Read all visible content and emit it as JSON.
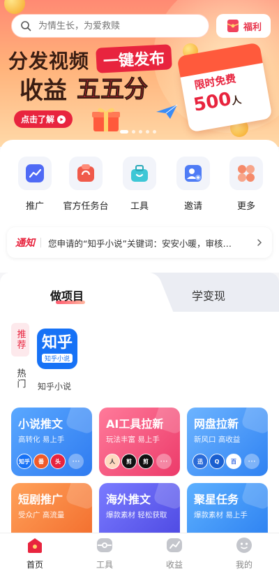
{
  "search": {
    "placeholder": "为情生长，为爱救赎"
  },
  "welfare": {
    "label": "福利",
    "icon": "red-envelope-icon"
  },
  "banner": {
    "line1": "分发视频",
    "pill": "一键发布",
    "line2": "收益",
    "line2_accent": "五五分",
    "cta": "点击了解",
    "calendar_line1": "限时免费",
    "calendar_number": "500",
    "calendar_unit": "人"
  },
  "quick_actions": [
    {
      "label": "推广",
      "icon": "trend-icon"
    },
    {
      "label": "官方任务台",
      "icon": "task-bag-icon"
    },
    {
      "label": "工具",
      "icon": "toolbox-icon"
    },
    {
      "label": "邀请",
      "icon": "invite-user-icon"
    },
    {
      "label": "更多",
      "icon": "grid-more-icon"
    }
  ],
  "notice": {
    "tag": "通知",
    "text": "您申请的“知乎小说”关键词：安安小暖，审核…"
  },
  "tabs": [
    {
      "label": "做项目"
    },
    {
      "label": "学变现"
    }
  ],
  "side_tabs": [
    {
      "label": "推荐"
    },
    {
      "label": "热门"
    }
  ],
  "featured": {
    "logo_big": "知乎",
    "logo_small": "知乎小说",
    "caption": "知乎小说"
  },
  "cards": [
    {
      "title": "小说推文",
      "sub": "高转化 易上手",
      "icons": [
        "知乎",
        "番",
        "头"
      ],
      "color": "#3e8ef7"
    },
    {
      "title": "AI工具拉新",
      "sub": "玩法丰富 易上手",
      "icons": [
        "人",
        "剪",
        "剪"
      ],
      "color": "#f2557a"
    },
    {
      "title": "网盘拉新",
      "sub": "新风口 高收益",
      "icons": [
        "迅",
        "Q",
        "百"
      ],
      "color": "#3c8cf5"
    },
    {
      "title": "短剧推广",
      "sub": "受众广 高流量",
      "icons": [],
      "color": "#f7813a"
    },
    {
      "title": "海外推文",
      "sub": "爆款素材 轻松获取",
      "icons": [],
      "color": "#5a5ff0"
    },
    {
      "title": "聚星任务",
      "sub": "爆款素材 易上手",
      "icons": [],
      "color": "#3a8cf6"
    }
  ],
  "bottom_nav": [
    {
      "label": "首页",
      "icon": "home-icon",
      "active": true
    },
    {
      "label": "工具",
      "icon": "tools-icon",
      "active": false
    },
    {
      "label": "收益",
      "icon": "earnings-chart-icon",
      "active": false
    },
    {
      "label": "我的",
      "icon": "profile-icon",
      "active": false
    }
  ]
}
